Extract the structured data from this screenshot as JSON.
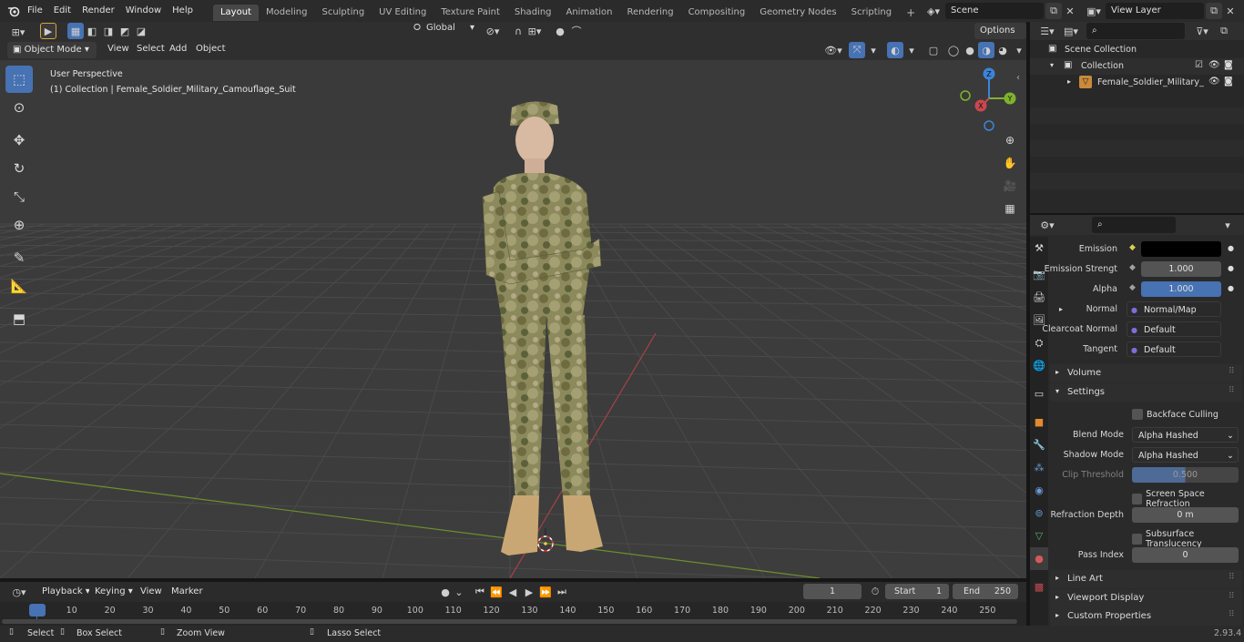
{
  "top_menu": [
    "File",
    "Edit",
    "Render",
    "Window",
    "Help"
  ],
  "workspace_tabs": [
    {
      "label": "Layout",
      "active": true
    },
    {
      "label": "Modeling"
    },
    {
      "label": "Sculpting"
    },
    {
      "label": "UV Editing"
    },
    {
      "label": "Texture Paint"
    },
    {
      "label": "Shading"
    },
    {
      "label": "Animation"
    },
    {
      "label": "Rendering"
    },
    {
      "label": "Compositing"
    },
    {
      "label": "Geometry Nodes"
    },
    {
      "label": "Scripting"
    }
  ],
  "add_workspace": "+",
  "scene_name": "Scene",
  "view_layer": "View Layer",
  "viewport_header": {
    "mode": "Object Mode",
    "menus": [
      "View",
      "Select",
      "Add",
      "Object"
    ],
    "transform_orientation": "Global",
    "options_label": "Options"
  },
  "viewport": {
    "perspective_label": "User Perspective",
    "collection_label": "(1) Collection | Female_Soldier_Military_Camouflage_Suit",
    "gizmo": {
      "x": "X",
      "y": "Y",
      "z": "Z"
    }
  },
  "outliner": {
    "search_placeholder": "",
    "scene_collection": "Scene Collection",
    "collection": "Collection",
    "object": "Female_Soldier_Military_"
  },
  "properties": {
    "rows": [
      {
        "label": "Emission",
        "value": "",
        "type": "color"
      },
      {
        "label": "Emission Strengt",
        "value": "1.000",
        "type": "number"
      },
      {
        "label": "Alpha",
        "value": "1.000",
        "type": "slider"
      },
      {
        "label": "Normal",
        "value": "Normal/Map",
        "type": "link"
      },
      {
        "label": "Clearcoat Normal",
        "value": "Default",
        "type": "link"
      },
      {
        "label": "Tangent",
        "value": "Default",
        "type": "link"
      }
    ],
    "sections": {
      "volume": "Volume",
      "settings": "Settings",
      "line_art": "Line Art",
      "viewport_display": "Viewport Display",
      "custom_properties": "Custom Properties"
    },
    "settings": {
      "backface_culling": "Backface Culling",
      "blend_mode_label": "Blend Mode",
      "blend_mode": "Alpha Hashed",
      "shadow_mode_label": "Shadow Mode",
      "shadow_mode": "Alpha Hashed",
      "clip_threshold_label": "Clip Threshold",
      "clip_threshold": "0.500",
      "screen_space_refraction": "Screen Space Refraction",
      "refraction_depth_label": "Refraction Depth",
      "refraction_depth": "0 m",
      "subsurface_translucency": "Subsurface Translucency",
      "pass_index_label": "Pass Index",
      "pass_index": "0"
    }
  },
  "timeline": {
    "menus": [
      "Playback",
      "Keying",
      "View",
      "Marker"
    ],
    "current_frame": "1",
    "start_label": "Start",
    "start": "1",
    "end_label": "End",
    "end": "250",
    "ticks": [
      "1",
      "10",
      "20",
      "30",
      "40",
      "50",
      "60",
      "70",
      "80",
      "90",
      "100",
      "110",
      "120",
      "130",
      "140",
      "150",
      "160",
      "170",
      "180",
      "190",
      "200",
      "210",
      "220",
      "230",
      "240",
      "250"
    ]
  },
  "statusbar": {
    "select": "Select",
    "box_select": "Box Select",
    "zoom_view": "Zoom View",
    "lasso_select": "Lasso Select",
    "version": "2.93.4"
  },
  "colors": {
    "accent": "#4772b3",
    "x_axis": "#c9474f",
    "y_axis": "#7fb32e",
    "z_axis": "#3b84d9"
  }
}
